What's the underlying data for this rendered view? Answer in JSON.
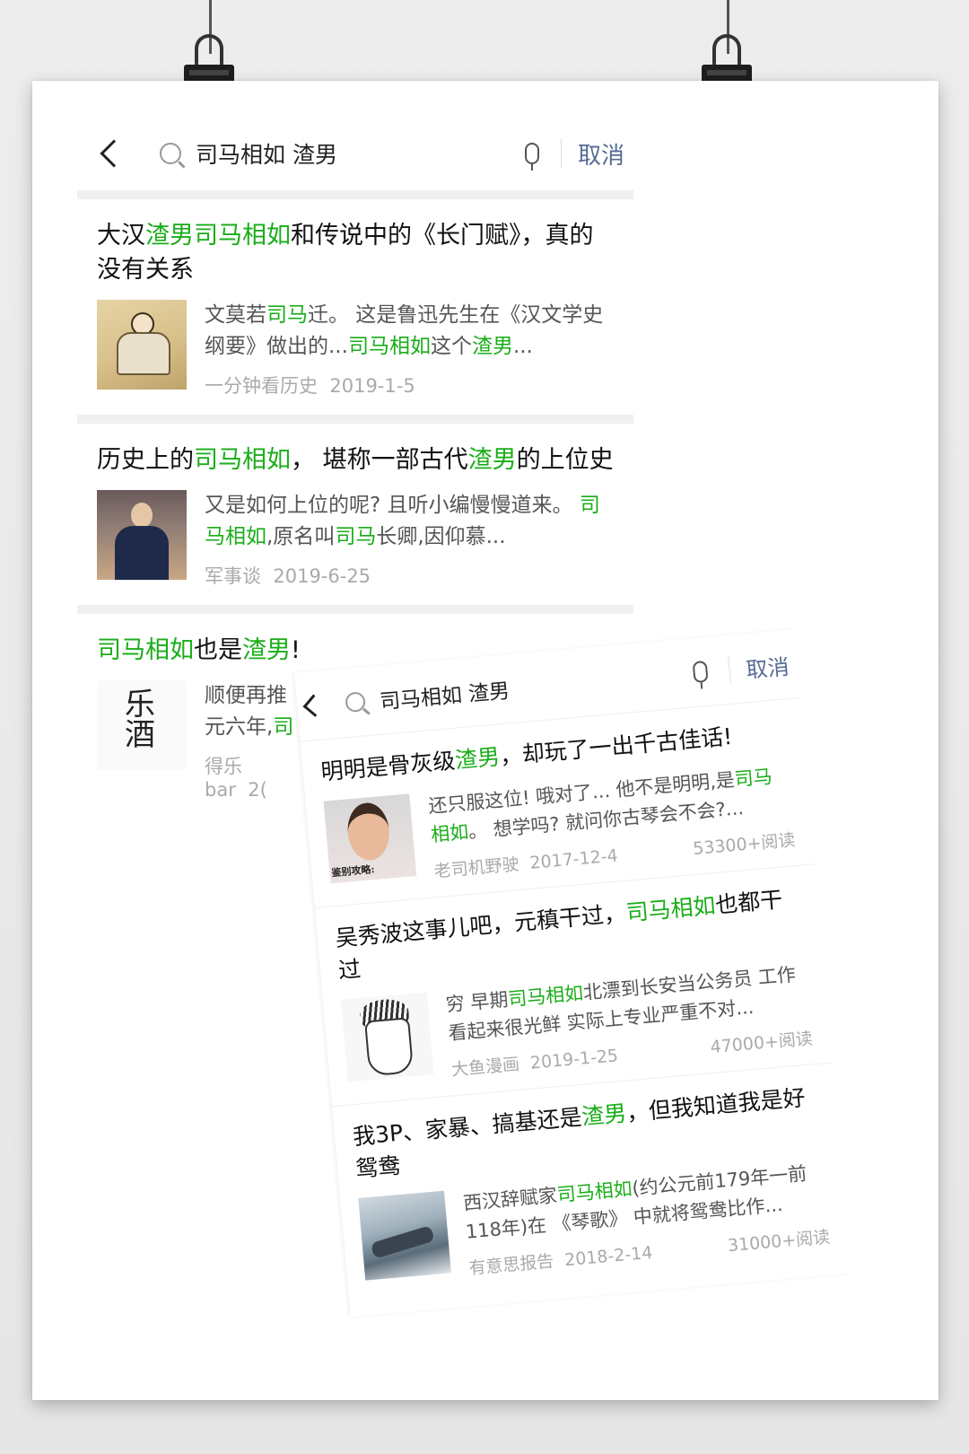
{
  "shot1": {
    "search": {
      "query": "司马相如 渣男",
      "cancel_label": "取消"
    },
    "results": [
      {
        "title": [
          {
            "t": "大汉",
            "h": false
          },
          {
            "t": "渣男",
            "h": true
          },
          {
            "t": "司马相如",
            "h": true
          },
          {
            "t": "和传说中的《长门赋》，真的没有关系",
            "h": false
          }
        ],
        "snippet": [
          {
            "t": "文莫若",
            "h": false
          },
          {
            "t": "司马",
            "h": true
          },
          {
            "t": "迁。 这是鲁迅先生在《汉文学史纲要》做出的...",
            "h": false
          },
          {
            "t": "司马相如",
            "h": true
          },
          {
            "t": "这个",
            "h": false
          },
          {
            "t": "渣男",
            "h": true
          },
          {
            "t": "...",
            "h": false
          }
        ],
        "source": "一分钟看历史",
        "date": "2019-1-5",
        "reads": "",
        "thumb_icon": "guqin-scholar-painting"
      },
      {
        "title": [
          {
            "t": "历史上的",
            "h": false
          },
          {
            "t": "司马相如",
            "h": true
          },
          {
            "t": "， 堪称一部古代",
            "h": false
          },
          {
            "t": "渣男",
            "h": true
          },
          {
            "t": "的上位史",
            "h": false
          }
        ],
        "snippet": [
          {
            "t": "又是如何上位的呢? 且听小编慢慢道来。 ",
            "h": false
          },
          {
            "t": "司马相如",
            "h": true
          },
          {
            "t": ",原名叫",
            "h": false
          },
          {
            "t": "司马",
            "h": true
          },
          {
            "t": "长卿,因仰慕...",
            "h": false
          }
        ],
        "source": "军事谈",
        "date": "2019-6-25",
        "reads": "",
        "thumb_icon": "drama-actor-photo"
      },
      {
        "title": [
          {
            "t": "司马相如",
            "h": true
          },
          {
            "t": "也是",
            "h": false
          },
          {
            "t": "渣男",
            "h": true
          },
          {
            "t": "!",
            "h": false
          }
        ],
        "snippet": [
          {
            "t": "顺便再推元六年,",
            "h": false
          },
          {
            "t": "司",
            "h": true
          }
        ],
        "source": "得乐bar",
        "date": "2(",
        "reads": "",
        "thumb_icon": "calligraphy-logo"
      }
    ]
  },
  "shot2": {
    "search": {
      "query": "司马相如 渣男",
      "cancel_label": "取消"
    },
    "results": [
      {
        "title": [
          {
            "t": "明明是骨灰级",
            "h": false
          },
          {
            "t": "渣男",
            "h": true
          },
          {
            "t": "，却玩了一出千古佳话!",
            "h": false
          }
        ],
        "snippet": [
          {
            "t": "还只服这位! 哦对了... 他不是明明,是",
            "h": false
          },
          {
            "t": "司马相如",
            "h": true
          },
          {
            "t": "。 想学吗? 就问你古琴会不会?...",
            "h": false
          }
        ],
        "source": "老司机野驶",
        "date": "2017-12-4",
        "reads": "53300+阅读",
        "thumb_icon": "man-portrait-photo",
        "thumb_caption": "鉴别攻略:"
      },
      {
        "title": [
          {
            "t": "吴秀波这事儿吧，元稹干过，",
            "h": false
          },
          {
            "t": "司马相如",
            "h": true
          },
          {
            "t": "也都干过",
            "h": false
          }
        ],
        "snippet": [
          {
            "t": "穷 早期",
            "h": false
          },
          {
            "t": "司马相如",
            "h": true
          },
          {
            "t": "北漂到长安当公务员 工作看起来很光鲜 实际上专业严重不对...",
            "h": false
          }
        ],
        "source": "大鱼漫画",
        "date": "2019-1-25",
        "reads": "47000+阅读",
        "thumb_icon": "caricature-sketch"
      },
      {
        "title": [
          {
            "t": "我3P、家暴、搞基还是",
            "h": false
          },
          {
            "t": "渣男",
            "h": true
          },
          {
            "t": "，但我知道我是好鸳鸯",
            "h": false
          }
        ],
        "snippet": [
          {
            "t": "西汉辞赋家",
            "h": false
          },
          {
            "t": "司马相如",
            "h": true
          },
          {
            "t": "(约公元前179年一前118年)在 《琴歌》 中就将鸳鸯比作...",
            "h": false
          }
        ],
        "source": "有意思报告",
        "date": "2018-2-14",
        "reads": "31000+阅读",
        "thumb_icon": "ink-landscape-painting"
      }
    ]
  },
  "colors": {
    "highlight": "#1aad19",
    "cancel": "#576b95",
    "meta": "#aaaaaa"
  }
}
